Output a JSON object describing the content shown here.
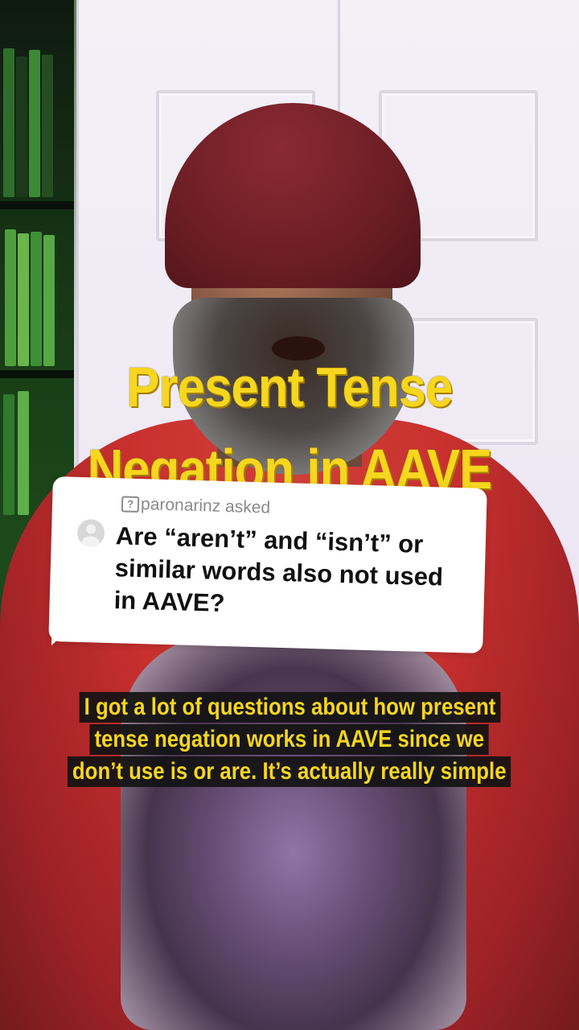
{
  "overlay_title": {
    "line1": "Present Tense",
    "line2": "Negation  in AAVE"
  },
  "comment_reply": {
    "username": "paronarinz asked",
    "question": "Are “aren’t” and “isn’t” or similar words also not used in AAVE?"
  },
  "caption": {
    "lines": [
      "I got a lot of questions about how present",
      "tense negation works in AAVE since we",
      "don’t use is or are. It’s actually really simple"
    ]
  },
  "colors": {
    "title": "#f7d61e",
    "caption_text": "#f7d61e",
    "caption_bg": "#121212",
    "card_bg": "#ffffff"
  }
}
